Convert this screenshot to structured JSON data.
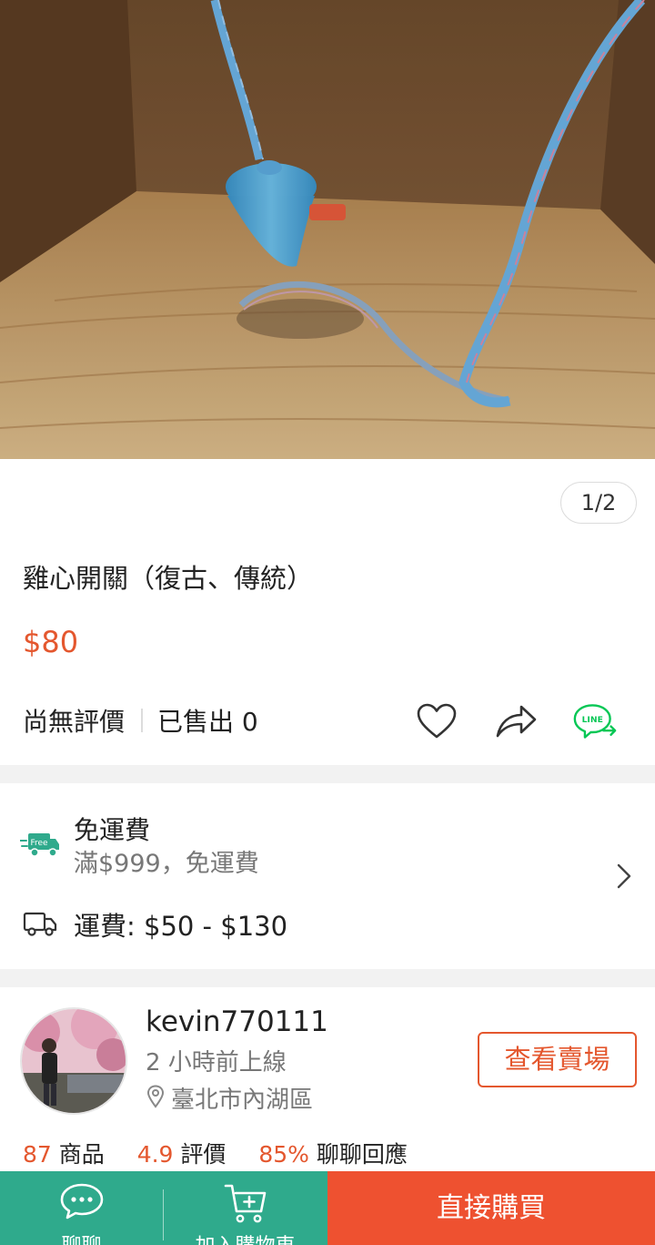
{
  "gallery": {
    "counter": "1/2"
  },
  "product": {
    "title": "雞心開關（復古、傳統）",
    "price": "$80",
    "rating_text": "尚無評價",
    "sold_text": "已售出 0"
  },
  "actions": {
    "favorite_icon": "heart-icon",
    "share_icon": "share-icon",
    "line_icon": "line-share-icon",
    "line_label": "LINE"
  },
  "shipping": {
    "free_badge": "Free",
    "free_title": "免運費",
    "free_sub": "滿$999，免運費",
    "fee": "運費: $50 - $130"
  },
  "seller": {
    "name": "kevin770111",
    "online": "2 小時前上線",
    "location": "臺北市內湖區",
    "view_shop": "查看賣場"
  },
  "stats": {
    "items_num": "87",
    "items_label": "商品",
    "rating_num": "4.9",
    "rating_label": "評價",
    "reply_num": "85%",
    "reply_label": "聊聊回應"
  },
  "bottom_bar": {
    "chat_label": "聊聊",
    "cart_label": "加入購物車",
    "buy_label": "直接購買"
  },
  "colors": {
    "accent": "#e4572e",
    "teal": "#2faa8c",
    "buy": "#ee5130",
    "line_green": "#06c755"
  }
}
